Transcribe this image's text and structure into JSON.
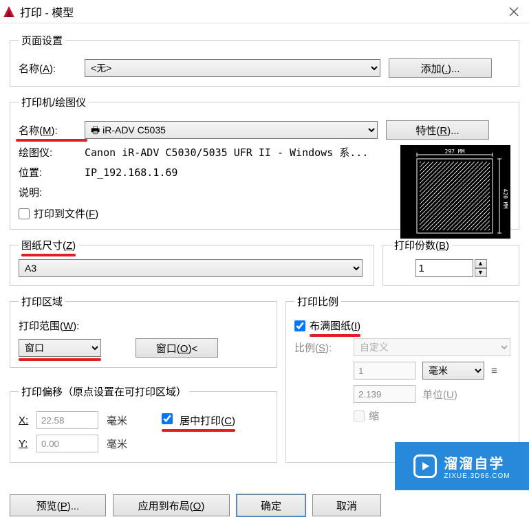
{
  "title": "打印 - 模型",
  "pageSetup": {
    "legend": "页面设置",
    "nameLabelPre": "名称(",
    "nameKey": "A",
    "nameLabelPost": "):",
    "nameValue": "<无>",
    "addBtnPre": "添加(",
    "addKey": ".",
    "addBtnPost": ")..."
  },
  "printer": {
    "legend": "打印机/绘图仪",
    "nameLabelPre": "名称(",
    "nameKey": "M",
    "nameLabelPost": "):",
    "nameValue": "🖶 iR-ADV C5035",
    "propBtnPre": "特性(",
    "propKey": "R",
    "propBtnPost": ")...",
    "plotterLabel": "绘图仪:",
    "plotterValue": "Canon iR-ADV C5030/5035 UFR II - Windows 系...",
    "locationLabel": "位置:",
    "locationValue": "IP_192.168.1.69",
    "descLabel": "说明:",
    "descValue": "",
    "fileLabelPre": "打印到文件(",
    "fileKey": "F",
    "fileLabelPost": ")",
    "fileChecked": false,
    "preview": {
      "width": "297 MM",
      "height": "420 MM"
    }
  },
  "paper": {
    "legendPre": "图纸尺寸(",
    "legendKey": "Z",
    "legendPost": ")",
    "value": "A3"
  },
  "copies": {
    "legendPre": "打印份数(",
    "legendKey": "B",
    "legendPost": ")",
    "value": "1"
  },
  "area": {
    "legend": "打印区域",
    "rangeLabelPre": "打印范围(",
    "rangeKey": "W",
    "rangeLabelPost": "):",
    "rangeValue": "窗口",
    "windowBtnPre": "窗口(",
    "windowKey": "O",
    "windowBtnPost": ")<"
  },
  "offset": {
    "legend": "打印偏移（原点设置在可打印区域）",
    "xLabel": "X:",
    "xValue": "22.58",
    "yLabel": "Y:",
    "yValue": "0.00",
    "unit": "毫米",
    "centerLabelPre": "居中打印(",
    "centerKey": "C",
    "centerLabelPost": ")",
    "centerChecked": true
  },
  "scale": {
    "legend": "打印比例",
    "fitLabelPre": "布满图纸(",
    "fitKey": "I",
    "fitLabelPost": ")",
    "fitChecked": true,
    "ratioLabelPre": "比例(",
    "ratioKey": "S",
    "ratioLabelPost": "):",
    "ratioValue": "自定义",
    "val1": "1",
    "unit1": "毫米",
    "eq": "≡",
    "val2": "2.139",
    "unit2LabelPre": "单位(",
    "unit2Key": "U",
    "unit2LabelPost": ")",
    "scaleLW": "缩"
  },
  "buttons": {
    "previewPre": "预览(",
    "previewKey": "P",
    "previewPost": ")...",
    "applyPre": "应用到布局(",
    "applyKey": "O",
    "applyPost": ")",
    "ok": "确定",
    "cancel": "取消"
  },
  "watermark": {
    "main": "溜溜自学",
    "sub": "ZIXUE.3D66.COM"
  }
}
